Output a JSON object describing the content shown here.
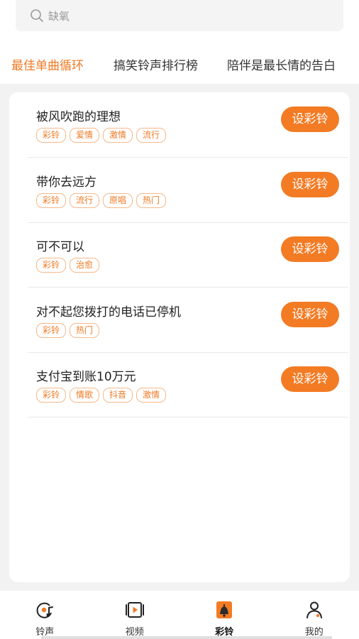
{
  "search": {
    "placeholder": "缺氧"
  },
  "tabs": [
    {
      "label": "最佳单曲循环",
      "active": true
    },
    {
      "label": "搞笑铃声排行榜",
      "active": false
    },
    {
      "label": "陪伴是最长情的告白",
      "active": false
    }
  ],
  "songs": [
    {
      "title": "被风吹跑的理想",
      "tags": [
        "彩铃",
        "爱情",
        "激情",
        "流行"
      ],
      "button": "设彩铃"
    },
    {
      "title": "带你去远方",
      "tags": [
        "彩铃",
        "流行",
        "原唱",
        "热门"
      ],
      "button": "设彩铃"
    },
    {
      "title": "可不可以",
      "tags": [
        "彩铃",
        "治愈"
      ],
      "button": "设彩铃"
    },
    {
      "title": "对不起您拨打的电话已停机",
      "tags": [
        "彩铃",
        "热门"
      ],
      "button": "设彩铃"
    },
    {
      "title": "支付宝到账10万元",
      "tags": [
        "彩铃",
        "情歌",
        "抖音",
        "激情"
      ],
      "button": "设彩铃"
    }
  ],
  "nav": [
    {
      "label": "铃声",
      "icon": "music-disc-icon",
      "active": false
    },
    {
      "label": "视频",
      "icon": "video-icon",
      "active": false
    },
    {
      "label": "彩铃",
      "icon": "ringtone-bell-icon",
      "active": true
    },
    {
      "label": "我的",
      "icon": "profile-icon",
      "active": false
    }
  ],
  "colors": {
    "accent": "#f37b24",
    "tag_border": "#f5b88a",
    "background": "#f2f2f2"
  }
}
